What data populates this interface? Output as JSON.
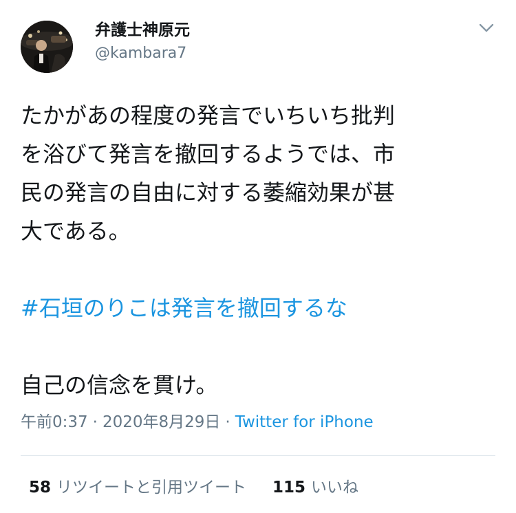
{
  "user": {
    "display_name": "弁護士神原元",
    "handle": "@kambara7",
    "avatar_icon": "profile-photo-avatar"
  },
  "tweet": {
    "lines": [
      "たかがあの程度の発言でいちいち批判",
      "を浴びて発言を撤回するようでは、市",
      "民の発言の自由に対する萎縮効果が甚",
      "大である。"
    ],
    "hashtag": "#石垣のりこは発言を撤回するな",
    "closing": "自己の信念を貫け。"
  },
  "meta": {
    "time": "午前0:37",
    "separator1": "·",
    "date": "2020年8月29日",
    "separator2": "·",
    "source": "Twitter for iPhone"
  },
  "stats": {
    "retweets_count": "58",
    "retweets_label": "リツイートと引用ツイート",
    "likes_count": "115",
    "likes_label": "いいね"
  },
  "colors": {
    "link": "#1b95e0",
    "secondary": "#657786",
    "primary_text": "#14171a",
    "divider": "#e1e8ed"
  }
}
